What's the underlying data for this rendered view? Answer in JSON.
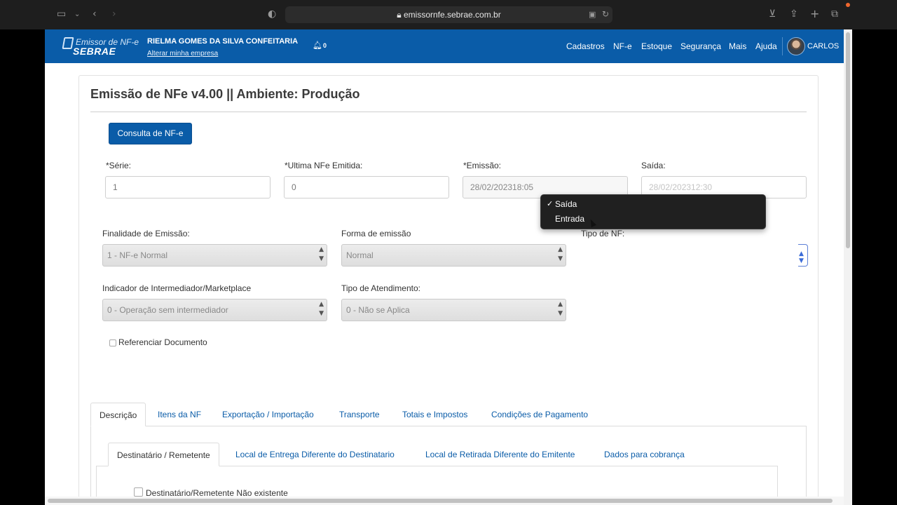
{
  "browser": {
    "url": "emissornfe.sebrae.com.br"
  },
  "navbar": {
    "logo_top": "Emissor de NF-e",
    "logo_bottom": "SEBRAE",
    "company_name": "RIELMA GOMES DA SILVA CONFEITARIA",
    "change_company": "Alterar minha empresa",
    "notifications": "0",
    "menu": [
      "Cadastros",
      "NF-e",
      "Estoque",
      "Segurança",
      "Mais",
      "Ajuda"
    ],
    "user": "CARLOS",
    "color": "#0a5ca8"
  },
  "page": {
    "title": "Emissão de NFe v4.00 || Ambiente: Produção",
    "consult_button": "Consulta de NF-e"
  },
  "fields": {
    "serie": {
      "label": "*Série:",
      "value": "1"
    },
    "ultima": {
      "label": "*Ultima NFe Emitida:",
      "value": "0"
    },
    "emissao": {
      "label": "*Emissão:",
      "value": "28/02/202318:05"
    },
    "saida": {
      "label": "Saída:",
      "value": "28/02/202312:30"
    }
  },
  "selects": {
    "finalidade": {
      "label": "Finalidade de Emissão:",
      "value": "1 - NF-e Normal"
    },
    "forma": {
      "label": "Forma de emissão",
      "value": "Normal"
    },
    "tipo": {
      "label": "Tipo de NF:",
      "options": [
        "Saída",
        "Entrada"
      ],
      "selected": "Saída"
    },
    "indicador": {
      "label": "Indicador de Intermediador/Marketplace",
      "value": "0 - Operação sem intermediador"
    },
    "atendimento": {
      "label": "Tipo de Atendimento:",
      "value": "0 - Não se Aplica"
    }
  },
  "referenciar_label": "Referenciar Documento",
  "tabs": [
    "Descrição",
    "Itens da NF",
    "Exportação / Importação",
    "Transporte",
    "Totais e Impostos",
    "Condições de Pagamento"
  ],
  "subtabs": [
    "Destinatário / Remetente",
    "Local de Entrega Diferente do Destinatario",
    "Local de Retirada Diferente do Emitente",
    "Dados para cobrança"
  ],
  "dest_nao_existente": "Destinatário/Remetente Não existente"
}
